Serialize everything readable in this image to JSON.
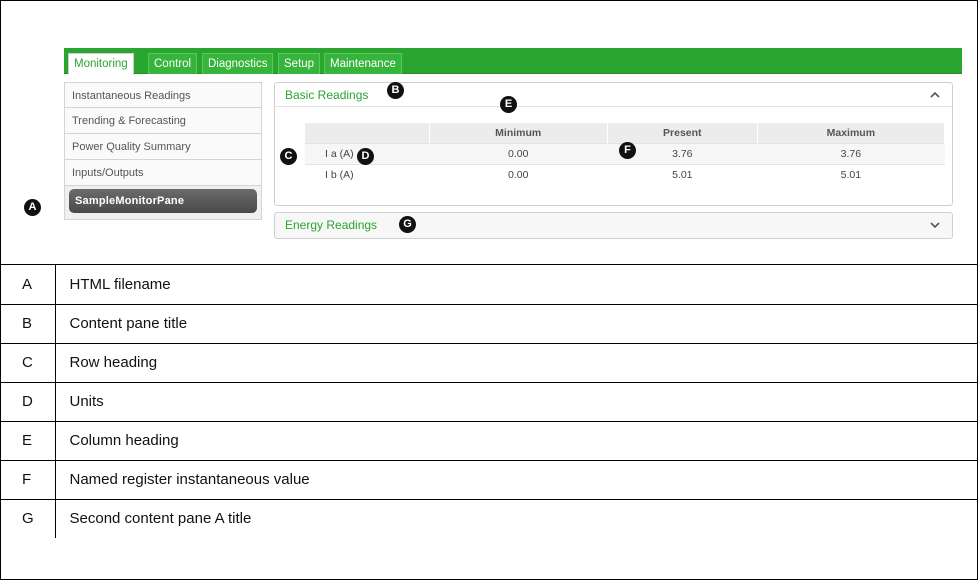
{
  "tabs": [
    {
      "label": "Monitoring",
      "active": true
    },
    {
      "label": "Control",
      "active": false
    },
    {
      "label": "Diagnostics",
      "active": false
    },
    {
      "label": "Setup",
      "active": false
    },
    {
      "label": "Maintenance",
      "active": false
    }
  ],
  "sidebar": {
    "items": [
      {
        "label": "Instantaneous Readings"
      },
      {
        "label": "Trending & Forecasting"
      },
      {
        "label": "Power Quality Summary"
      },
      {
        "label": "Inputs/Outputs"
      },
      {
        "label": "SampleMonitorPane",
        "selected": true
      }
    ]
  },
  "pane1": {
    "title": "Basic Readings",
    "expanded": true,
    "columns": [
      "",
      "Minimum",
      "Present",
      "Maximum"
    ],
    "rows": [
      {
        "label": "I a (A)",
        "min": "0.00",
        "present": "3.76",
        "max": "3.76"
      },
      {
        "label": "I b (A)",
        "min": "0.00",
        "present": "5.01",
        "max": "5.01"
      }
    ]
  },
  "pane2": {
    "title": "Energy Readings",
    "expanded": false
  },
  "callouts": {
    "a": "A",
    "b": "B",
    "c": "C",
    "d": "D",
    "e": "E",
    "f": "F",
    "g": "G"
  },
  "legend": [
    {
      "key": "A",
      "desc": "HTML filename"
    },
    {
      "key": "B",
      "desc": "Content pane title"
    },
    {
      "key": "C",
      "desc": "Row heading"
    },
    {
      "key": "D",
      "desc": "Units"
    },
    {
      "key": "E",
      "desc": "Column heading"
    },
    {
      "key": "F",
      "desc": "Named register instantaneous value"
    },
    {
      "key": "G",
      "desc": "Second content pane A title"
    }
  ],
  "colors": {
    "tab_bar": "#2aa52f",
    "pane_title": "#2aa52f",
    "selected_item": "#555555"
  },
  "icons": {
    "pane1_toggle": "chevron-up-icon",
    "pane2_toggle": "chevron-down-icon"
  }
}
